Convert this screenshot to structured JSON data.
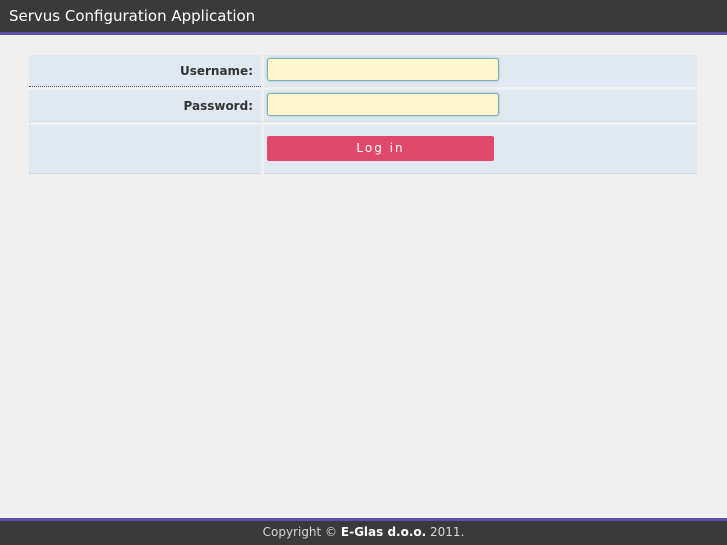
{
  "header": {
    "title": "Servus Configuration Application"
  },
  "login_form": {
    "username_label": "Username:",
    "username_value": "",
    "password_label": "Password:",
    "password_value": "",
    "login_label": "Log in"
  },
  "footer": {
    "copyright_prefix": "Copyright ©",
    "company": "E-Glas d.o.o.",
    "year": "2011."
  },
  "colors": {
    "header_bg": "#3a3a3a",
    "accent_bar": "#5b4fa8",
    "form_cell_bg": "#e0e9f1",
    "input_bg": "#fff6cc",
    "login_button_bg": "#e1496a"
  }
}
